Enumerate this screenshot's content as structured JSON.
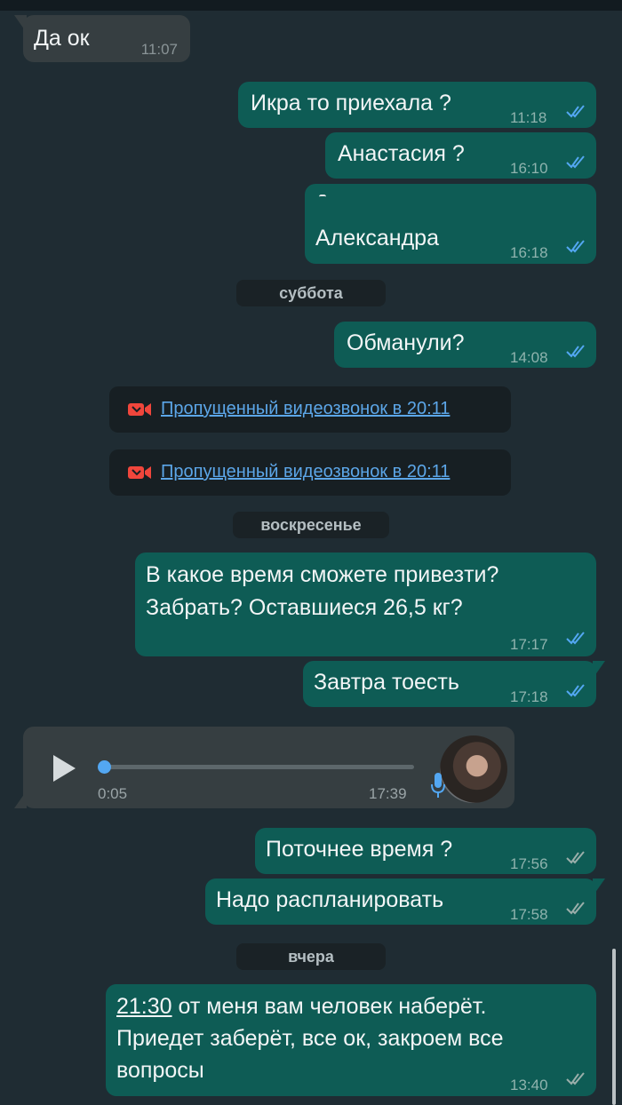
{
  "messages": [
    {
      "text": "Да ок",
      "time": "11:07"
    },
    {
      "text": "Икра то приехала ?",
      "time": "11:18"
    },
    {
      "text": "Анастасия ?",
      "time": "16:10"
    },
    {
      "text": "Александра",
      "time": "16:18"
    },
    {
      "text": "Обманули?",
      "time": "14:08"
    },
    {
      "line1": "В какое время сможете привезти?",
      "line2": "Забрать? Оставшиеся 26,5 кг?",
      "time": "17:17"
    },
    {
      "text": "Завтра тоесть",
      "time": "17:18"
    },
    {
      "text": "Поточнее время ?",
      "time": "17:56"
    },
    {
      "text": "Надо распланировать",
      "time": "17:58"
    },
    {
      "link": "21:30",
      "line1_rest": " от меня вам человек наберёт.",
      "line2": "Приедет заберёт, все ок, закроем все",
      "line3": "вопросы",
      "time": "13:40"
    }
  ],
  "day_separators": [
    "суббота",
    "воскресенье",
    "вчера"
  ],
  "missed_calls": [
    {
      "text": "Пропущенный видеозвонок в 20:11"
    },
    {
      "text": "Пропущенный видеозвонок в 20:11"
    }
  ],
  "voice_message": {
    "duration": "0:05",
    "time": "17:39",
    "progress": 0.0
  },
  "icons": {
    "read_ticks": "double-check-blue",
    "delivered_ticks": "double-check-gray",
    "missed_call": "video-camera-missed-red",
    "play": "play-icon",
    "mic": "microphone-blue"
  },
  "colors": {
    "read": "#53a7f2",
    "delivered": "#9aaeaa",
    "missed": "#f0463c",
    "link": "#5ca6e8"
  }
}
